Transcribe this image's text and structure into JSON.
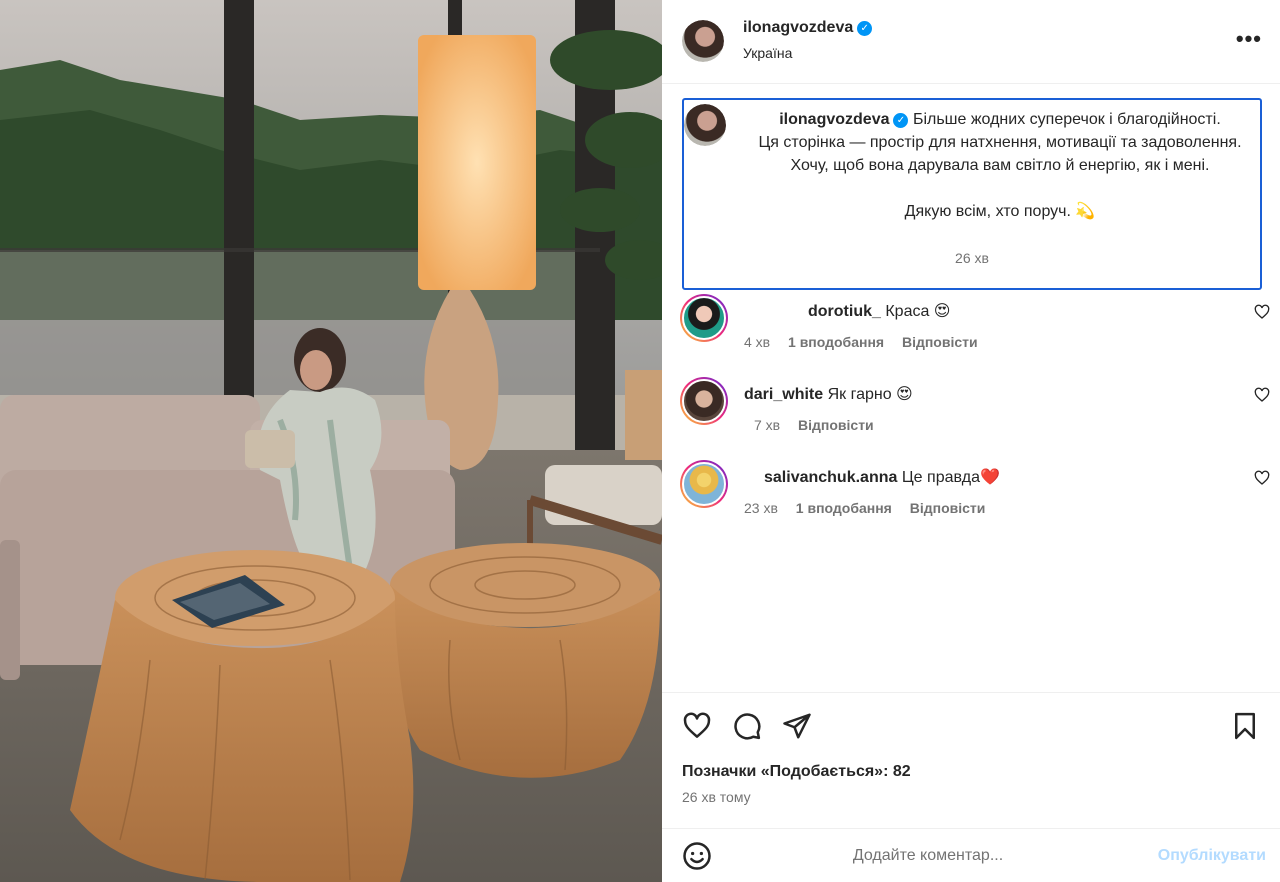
{
  "post": {
    "username": "ilonagvozdeva",
    "location": "Україна",
    "more_label": "•••"
  },
  "caption": {
    "username": "ilonagvozdeva",
    "line1": "Більше жодних суперечок і благодійності.",
    "line2": "Ця сторінка — простір для натхнення, мотивації та задоволення.",
    "line3": "Хочу, щоб вона дарувала вам світло й енергію, як і мені.",
    "line4": "Дякую всім, хто поруч.",
    "line4_emoji": "💫",
    "time": "26 хв"
  },
  "comments": [
    {
      "username": "dorotiuk_",
      "text": "Краса 😍",
      "time": "4 хв",
      "likes": "1 вподобання",
      "reply": "Відповісти",
      "avatar_color": "#1f9b88"
    },
    {
      "username": "dari_white",
      "text": "Як гарно 😍",
      "time": "7 хв",
      "likes": "",
      "reply": "Відповісти",
      "avatar_color": "#3a2a24"
    },
    {
      "username": "salivanchuk.anna",
      "text": "Це правда❤️",
      "time": "23 хв",
      "likes": "1 вподобання",
      "reply": "Відповісти",
      "avatar_color": "#7fb4d8"
    }
  ],
  "actions": {
    "icons": [
      "heart-icon",
      "comment-icon",
      "share-icon",
      "bookmark-icon"
    ],
    "likes_text": "Позначки «Подобається»: 82",
    "date": "26 хв тому"
  },
  "composer": {
    "emoji_icon": "smiley-icon",
    "placeholder": "Додайте коментар...",
    "publish": "Опублікувати"
  },
  "colors": {
    "verified": "#0095f6",
    "publish_disabled": "#b3dbff",
    "caption_border": "#1a5fd6",
    "muted_text": "#737373"
  }
}
